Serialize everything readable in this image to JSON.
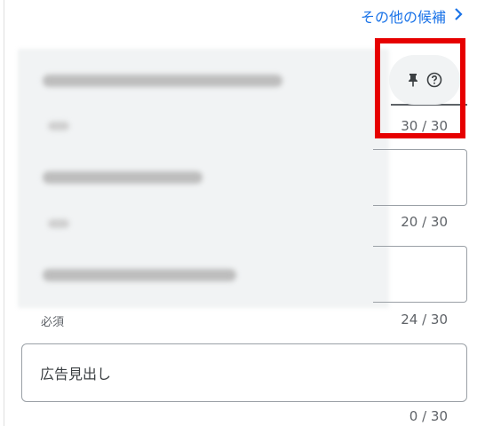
{
  "header": {
    "more_candidates_label": "その他の候補",
    "accent_color": "#1a73e8"
  },
  "fields": [
    {
      "counter": "30 / 30"
    },
    {
      "counter": "20 / 30"
    },
    {
      "counter": "24 / 30",
      "required_label": "必須"
    },
    {
      "placeholder": "広告見出し",
      "counter": "0 / 30"
    }
  ],
  "icons": {
    "pin": "pin-icon",
    "help": "help-circle-icon",
    "chevron": "chevron-right-icon"
  },
  "highlight_color": "#e60000"
}
